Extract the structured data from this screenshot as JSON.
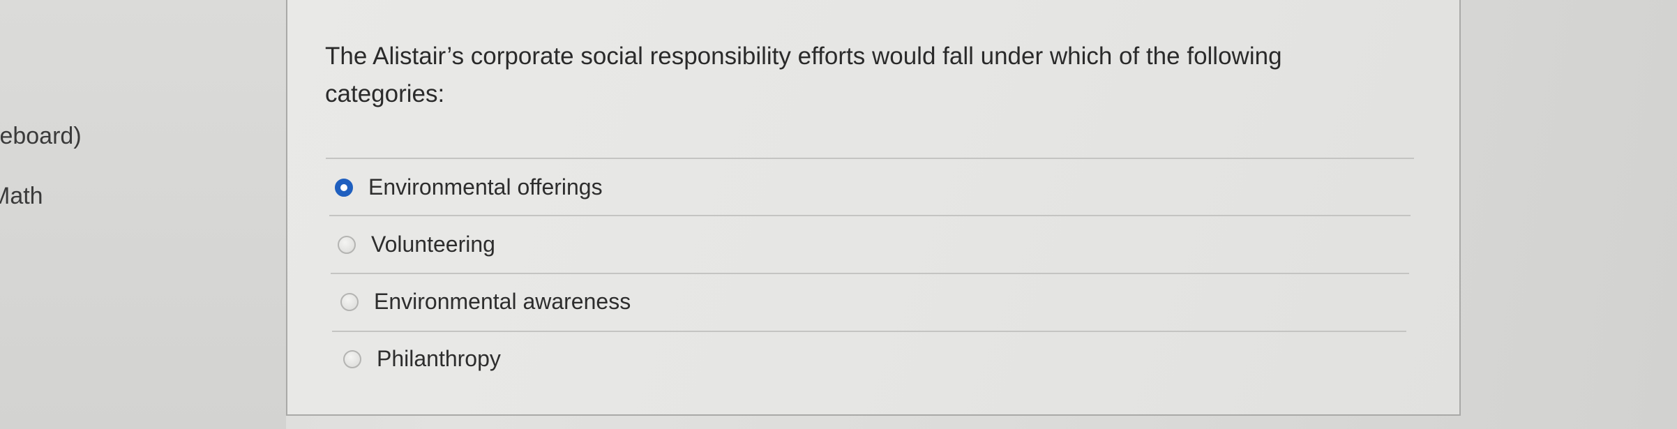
{
  "sidebar": {
    "items": [
      {
        "label": "teboard)"
      },
      {
        "label": "Math"
      }
    ]
  },
  "question": {
    "text": "The Alistair’s corporate social responsibility efforts would fall under which of the following categories:"
  },
  "options": [
    {
      "label": "Environmental offerings",
      "selected": true
    },
    {
      "label": "Volunteering",
      "selected": false
    },
    {
      "label": "Environmental awareness",
      "selected": false
    },
    {
      "label": "Philanthropy",
      "selected": false
    }
  ],
  "colors": {
    "radio_selected": "#1f5fbf"
  }
}
